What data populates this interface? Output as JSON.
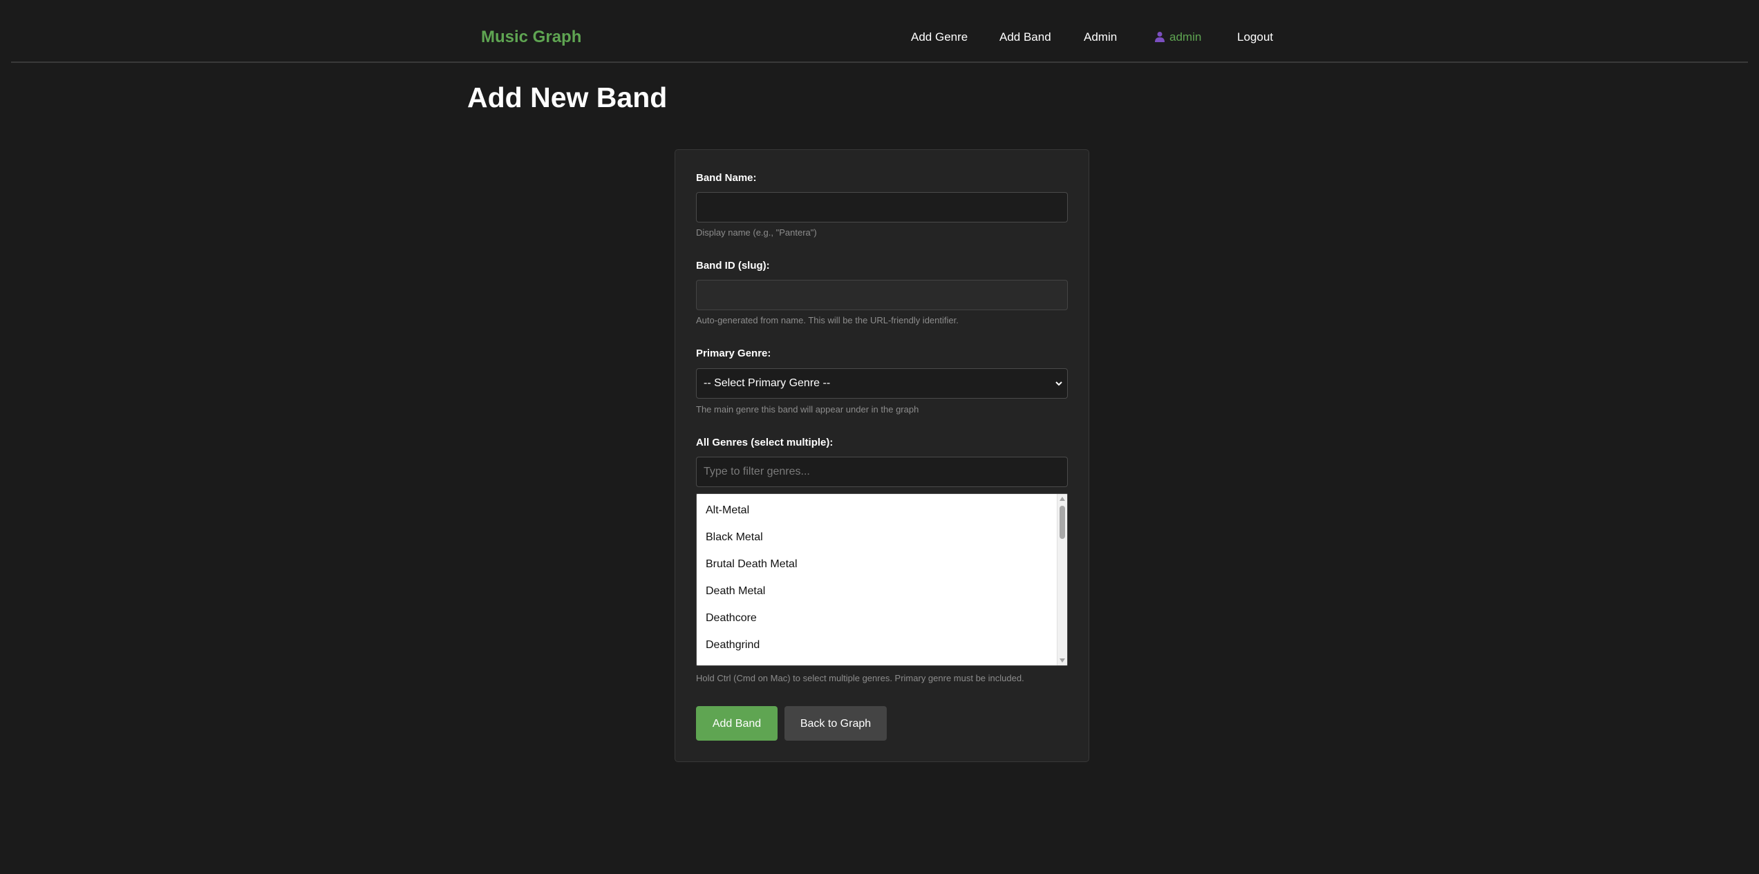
{
  "nav": {
    "brand": "Music Graph",
    "links": [
      "Add Genre",
      "Add Band",
      "Admin"
    ],
    "user": "admin",
    "logout": "Logout"
  },
  "page": {
    "title": "Add New Band"
  },
  "form": {
    "band_name": {
      "label": "Band Name:",
      "value": "",
      "help": "Display name (e.g., \"Pantera\")"
    },
    "band_id": {
      "label": "Band ID (slug):",
      "value": "",
      "help": "Auto-generated from name. This will be the URL-friendly identifier."
    },
    "primary_genre": {
      "label": "Primary Genre:",
      "selected": "-- Select Primary Genre --",
      "help": "The main genre this band will appear under in the graph"
    },
    "all_genres": {
      "label": "All Genres (select multiple):",
      "filter_placeholder": "Type to filter genres...",
      "options": [
        "Alt-Metal",
        "Black Metal",
        "Brutal Death Metal",
        "Death Metal",
        "Deathcore",
        "Deathgrind"
      ],
      "help": "Hold Ctrl (Cmd on Mac) to select multiple genres. Primary genre must be included."
    },
    "submit_label": "Add Band",
    "back_label": "Back to Graph"
  },
  "colors": {
    "accent": "#5fa552",
    "background": "#1b1b1b",
    "card": "#242424",
    "user_icon": "#7b4fc0"
  }
}
